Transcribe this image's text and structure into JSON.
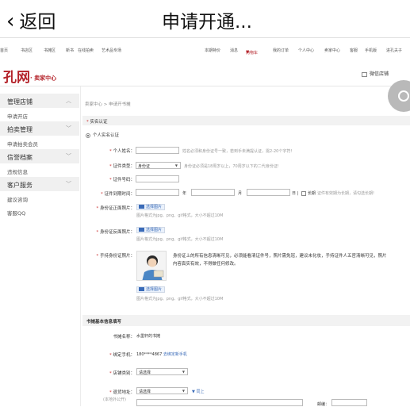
{
  "header": {
    "back_label": "返回",
    "title": "申请开通..."
  },
  "topnav": [
    "首页",
    "书店区",
    "书摊区",
    "新书",
    "在线拍卖",
    "艺术品专场",
    "本期特价",
    "消息",
    "购物车",
    "我的订单",
    "个人中心",
    "卖家中心",
    "客服",
    "手机版",
    "进孔夫子"
  ],
  "logo": {
    "main": "孔网",
    "sub": "· 卖家中心"
  },
  "wechat": "微信店铺",
  "sidebar": [
    {
      "group": "管理店铺",
      "items": [
        "申请开店"
      ]
    },
    {
      "group": "拍卖管理",
      "items": [
        "申请拍卖会员"
      ]
    },
    {
      "group": "信誉档案",
      "items": [
        "违规信息"
      ]
    },
    {
      "group": "客户服务",
      "items": [
        "建议咨询",
        "客服QQ"
      ]
    }
  ],
  "breadcrumb": "卖家中心 > 申请开书摊",
  "section1": {
    "title": "实名认证",
    "radio": "个人实名认证"
  },
  "form": {
    "name_label": "个人姓名：",
    "name_hint": "姓名必须和身份证号一致，若到手未满提认证，需2-20个字符!",
    "idtype_label": "证件类型：",
    "idtype_value": "身份证",
    "idtype_hint": "身份证必须是18周岁以上，70周岁以下的二代身份证!",
    "idno_label": "证件号码：",
    "expire_label": "证件到期时间：",
    "year": "年",
    "month": "月",
    "day": "日",
    "longterm": "长期",
    "expire_hint": "证件有效期为长期，请勾选长期!",
    "front_label": "身份证正面照片：",
    "back_label": "身份证反面照片：",
    "hold_label": "手持身份证照片：",
    "choose_img": "选择图片",
    "img_hint": "图片格式为jpg、png、gif格式，大小不超过10M",
    "hold_desc": "身份证上的所有信息清晰可见，必须能看清证件号，照片需免冠，建议未化妆，手持证件人五官清晰可见，照片内容真实有效，不得做任何修改。"
  },
  "section2": {
    "title": "书摊基本信息填写"
  },
  "shop": {
    "name_label": "书摊名称：",
    "name_value": "水墨轩的书摊",
    "phone_label": "绑定手机：",
    "phone_value": "180****4867",
    "phone_link": "去绑定新手机",
    "cat_label": "店铺类别：",
    "cat_value": "请选择",
    "addr_label": "退货地址：",
    "addr_sub": "(本地外公开)",
    "addr_value": "请选择",
    "addr_link": "同上",
    "zip_label": "邮编："
  }
}
